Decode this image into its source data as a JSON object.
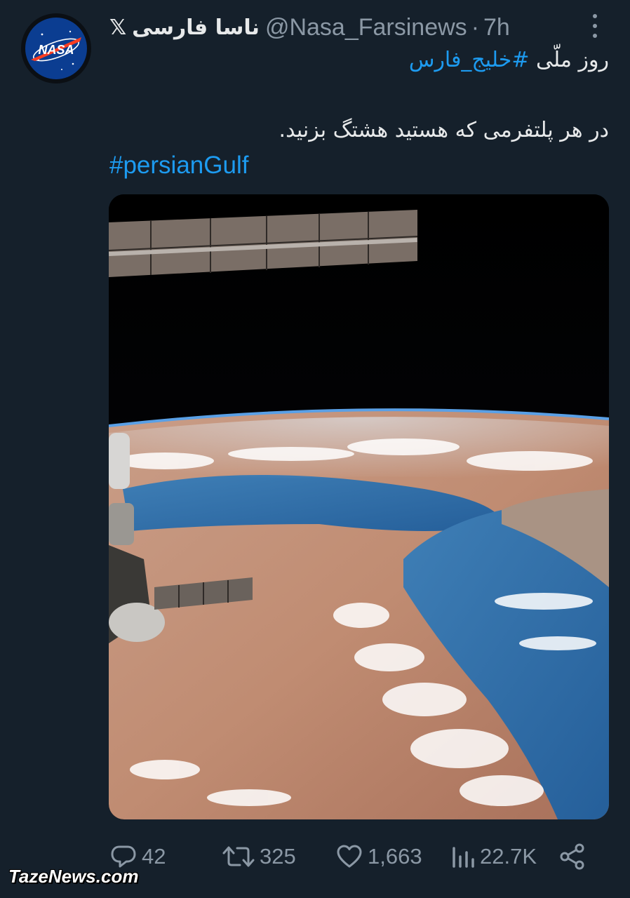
{
  "tweet": {
    "author": {
      "avatar_label": "NASA",
      "display_name": "ناسا فارسی",
      "platform_badge": "𝕏",
      "handle": "@Nasa_Farsinews",
      "separator": "·",
      "time": "7h"
    },
    "text": {
      "line1_plain": "روز ملّی ",
      "line1_hashtag": "#خلیج_فارس",
      "line2": "در هر پلتفرمی که هستید هشتگ بزنید.",
      "line3_hashtag": "#persianGulf"
    },
    "media": {
      "icon": "earth-from-iss-photo"
    },
    "metrics": {
      "replies": "42",
      "reposts": "325",
      "likes": "1,663",
      "views": "22.7K"
    }
  },
  "watermark": "TazeNews.com",
  "colors": {
    "background": "#15202b",
    "primary_text": "#e7e9ea",
    "secondary_text": "#8b98a5",
    "link": "#1d9bf0"
  }
}
